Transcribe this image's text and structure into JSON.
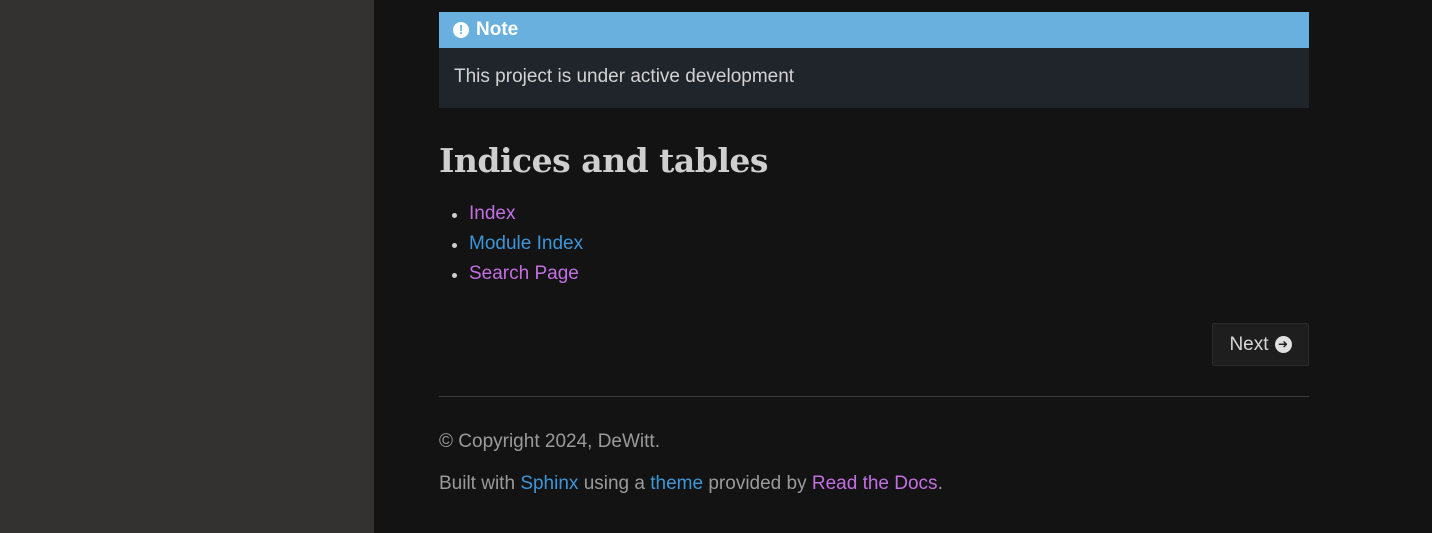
{
  "note": {
    "title": "Note",
    "icon": "exclamation-circle-icon",
    "body": "This project is under active development"
  },
  "section": {
    "heading": "Indices and tables",
    "links": [
      {
        "label": "Index",
        "visited": true
      },
      {
        "label": "Module Index",
        "visited": false
      },
      {
        "label": "Search Page",
        "visited": true
      }
    ]
  },
  "navigation": {
    "next_label": "Next",
    "next_icon": "arrow-circle-right-icon"
  },
  "footer": {
    "copyright": "© Copyright 2024, DeWitt.",
    "built_prefix": "Built with",
    "sphinx": "Sphinx",
    "using_a": "using a",
    "theme": "theme",
    "provided_by": "provided by",
    "read_the_docs": "Read the Docs",
    "period": "."
  },
  "colors": {
    "sidebar_bg": "#343131",
    "content_bg": "#131313",
    "note_title_bg": "#6ab0de",
    "note_body_bg": "#1f252b",
    "link": "#3e95d8",
    "link_visited": "#c36fe3"
  }
}
